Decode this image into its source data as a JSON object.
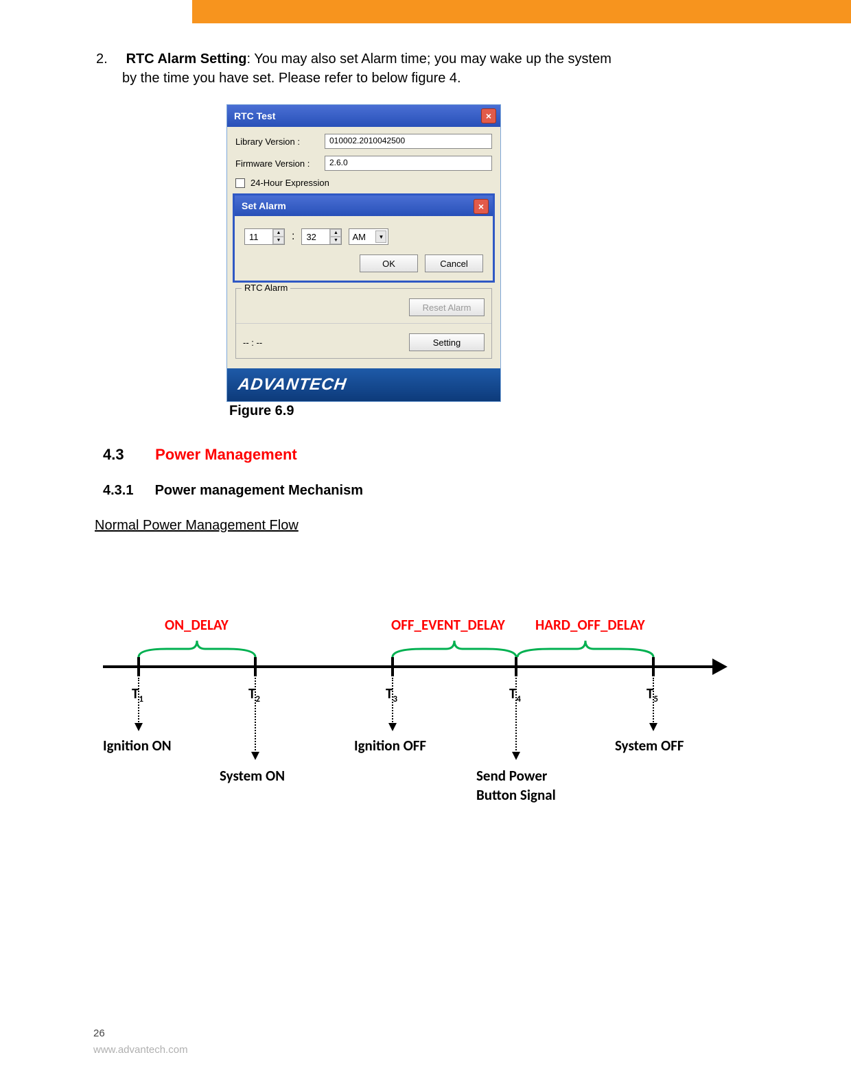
{
  "step": {
    "num": "2.",
    "bold": "RTC Alarm Setting",
    "text1": ": You may also set Alarm time; you may wake up the system",
    "text2": "by the time you have set. Please refer to below figure 4."
  },
  "rtc": {
    "title": "RTC Test",
    "lib_label": "Library Version :",
    "lib_val": "010002.2010042500",
    "fw_label": "Firmware Version :",
    "fw_val": "2.6.0",
    "chk24": "24-Hour Expression",
    "alarm_title": "Set Alarm",
    "hour": "11",
    "min": "32",
    "ampm": "AM",
    "ok": "OK",
    "cancel": "Cancel",
    "group": "RTC Alarm",
    "reset": "Reset Alarm",
    "dashes": "-- : --",
    "setting": "Setting",
    "logo": "ADVANTECH"
  },
  "fig_cap": "Figure 6.9",
  "sec": {
    "num": "4.3",
    "title": "Power Management"
  },
  "sub": {
    "num": "4.3.1",
    "title": "Power management Mechanism"
  },
  "flow_h": "Normal Power Management Flow",
  "tl": {
    "d1": "ON_DELAY",
    "d2": "OFF_EVENT_DELAY",
    "d3": "HARD_OFF_DELAY",
    "t1": "T",
    "t1s": "1",
    "t2": "T",
    "t2s": "2",
    "t3": "T",
    "t3s": "3",
    "t4": "T",
    "t4s": "4",
    "t5": "T",
    "t5s": "5",
    "e1": "Ignition ON",
    "e2": "System ON",
    "e3": "Ignition OFF",
    "e4a": "Send Power",
    "e4b": "Button Signal",
    "e5": "System OFF"
  },
  "page_num": "26",
  "footer_url": "www.advantech.com"
}
